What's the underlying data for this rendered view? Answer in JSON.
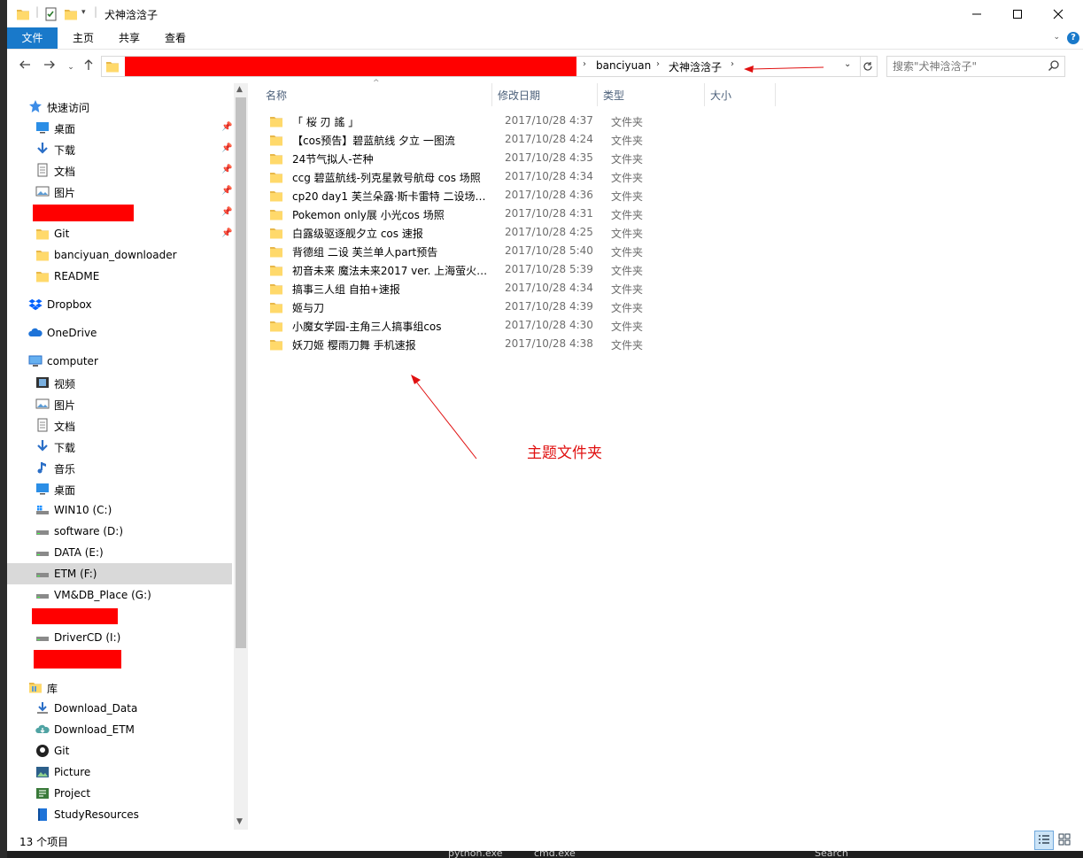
{
  "window": {
    "title": "犬神浛浛子"
  },
  "ribbon": {
    "tabs": [
      "文件",
      "主页",
      "共享",
      "查看"
    ]
  },
  "address": {
    "breadcrumbs": [
      "banciyuan",
      "犬神浛浛子"
    ],
    "search_placeholder": "搜索\"犬神浛浛子\""
  },
  "nav": {
    "quick_access": "快速访问",
    "quick_items": [
      "桌面",
      "下载",
      "文档",
      "图片",
      "Git",
      "banciyuan_downloader",
      "README"
    ],
    "dropbox": "Dropbox",
    "onedrive": "OneDrive",
    "computer": "computer",
    "computer_items": [
      "视频",
      "图片",
      "文档",
      "下载",
      "音乐",
      "桌面",
      "WIN10 (C:)",
      "software (D:)",
      "DATA (E:)",
      "ETM (F:)",
      "VM&DB_Place (G:)",
      "DriverCD (I:)"
    ],
    "library": "库",
    "library_items": [
      "Download_Data",
      "Download_ETM",
      "Git",
      "Picture",
      "Project",
      "StudyResources"
    ]
  },
  "columns": {
    "name": "名称",
    "modified": "修改日期",
    "type": "类型",
    "size": "大小"
  },
  "files": [
    {
      "name": "「 桜 刃 謠 」",
      "date": "2017/10/28 4:37",
      "type": "文件夹"
    },
    {
      "name": "【cos预告】碧蓝航线 夕立 一图流",
      "date": "2017/10/28 4:24",
      "type": "文件夹"
    },
    {
      "name": "24节气拟人-芒种",
      "date": "2017/10/28 4:35",
      "type": "文件夹"
    },
    {
      "name": "ccg 碧蓝航线-列克星敦号航母 cos 场照",
      "date": "2017/10/28 4:34",
      "type": "文件夹"
    },
    {
      "name": "cp20 day1 芙兰朵露·斯卡雷特 二设场照...",
      "date": "2017/10/28 4:36",
      "type": "文件夹"
    },
    {
      "name": "Pokemon only展 小光cos 场照",
      "date": "2017/10/28 4:31",
      "type": "文件夹"
    },
    {
      "name": "白露级驱逐舰夕立 cos 速报",
      "date": "2017/10/28 4:25",
      "type": "文件夹"
    },
    {
      "name": "背德组 二设 芙兰单人part预告",
      "date": "2017/10/28 5:40",
      "type": "文件夹"
    },
    {
      "name": "初音未来 魔法未来2017 ver. 上海萤火虫...",
      "date": "2017/10/28 5:39",
      "type": "文件夹"
    },
    {
      "name": "搞事三人组 自拍+速报",
      "date": "2017/10/28 4:34",
      "type": "文件夹"
    },
    {
      "name": "姬与刀",
      "date": "2017/10/28 4:39",
      "type": "文件夹"
    },
    {
      "name": "小魔女学园-主角三人搞事组cos",
      "date": "2017/10/28 4:30",
      "type": "文件夹"
    },
    {
      "name": "妖刀姬 樱雨刀舞 手机速报",
      "date": "2017/10/28 4:38",
      "type": "文件夹"
    }
  ],
  "annotation": {
    "label": "主题文件夹"
  },
  "status": {
    "count": "13 个项目"
  },
  "taskbar": {
    "items": [
      "python.exe",
      "cmd.exe",
      "Search"
    ]
  },
  "colors": {
    "accent": "#1979ca",
    "annotation_red": "#ff0000",
    "folder_yellow": "#ffd96b",
    "selected_nav": "#d9d9d9"
  }
}
